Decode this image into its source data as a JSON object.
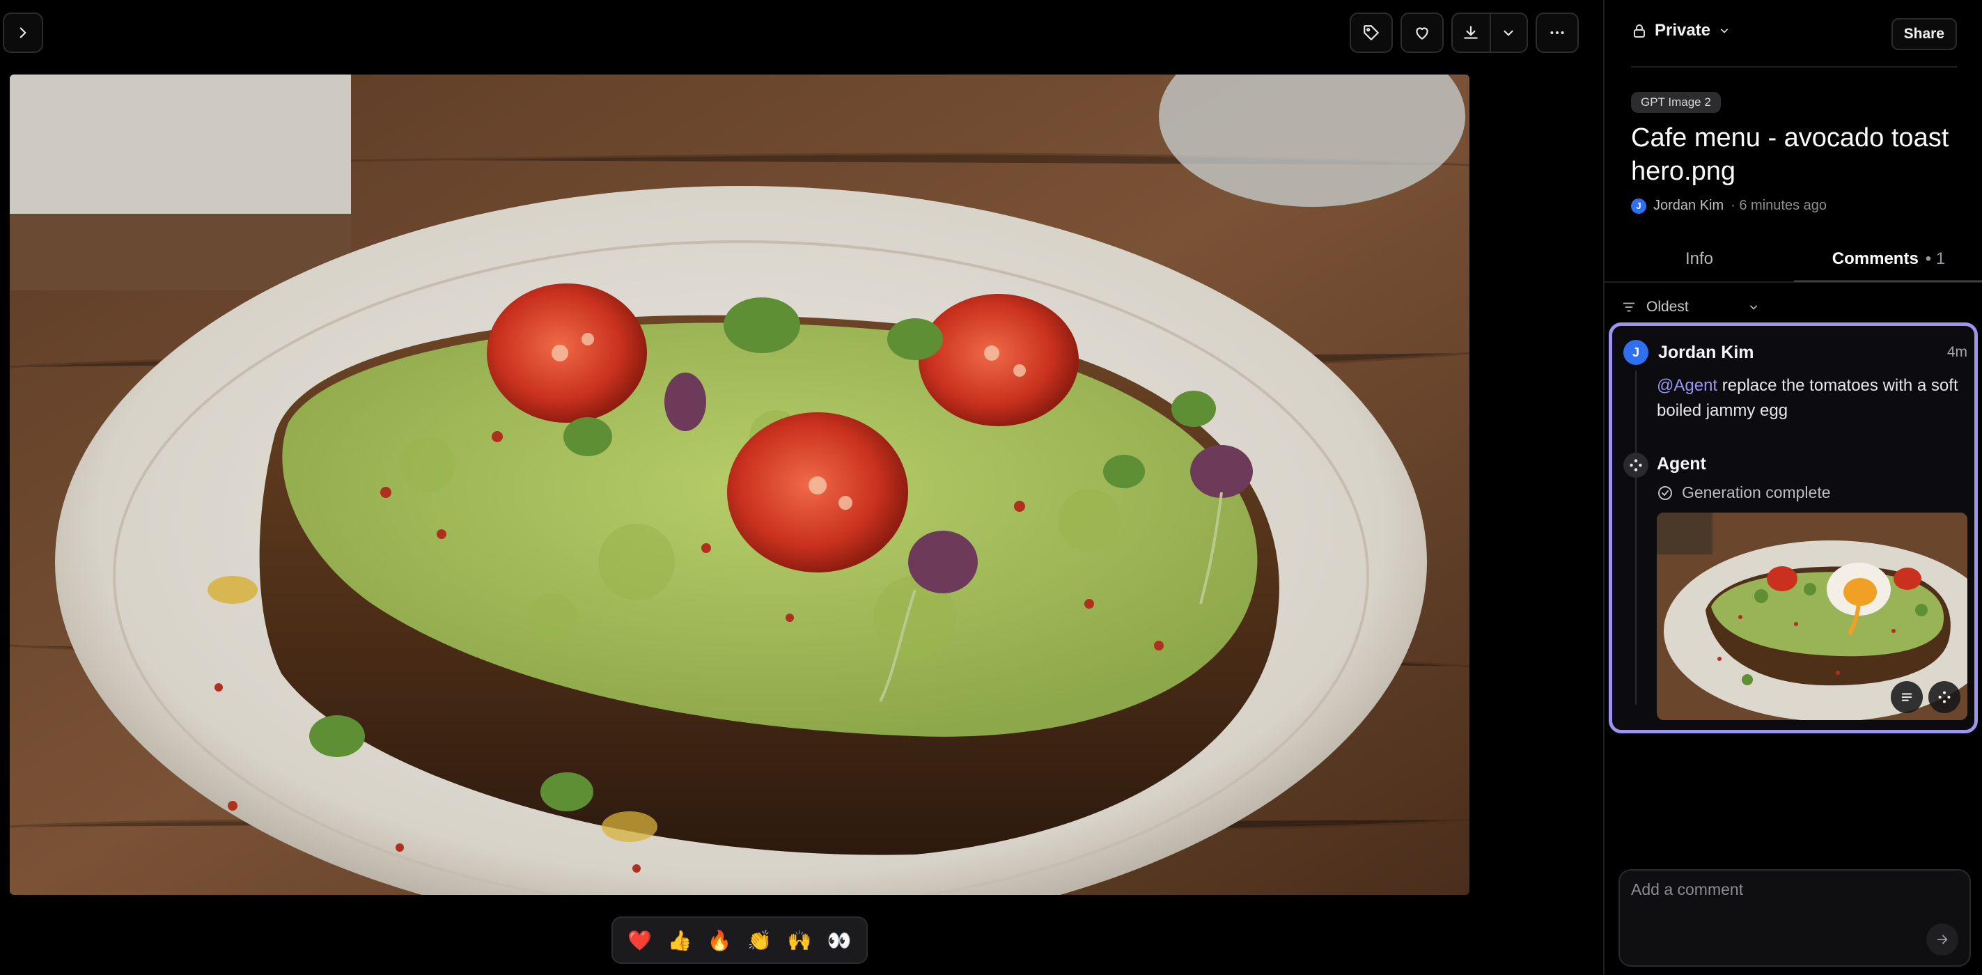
{
  "toolbar": {
    "icons": [
      "chevron-right-icon",
      "tag-icon",
      "heart-icon",
      "download-icon",
      "chevron-down-icon",
      "more-horizontal-icon"
    ]
  },
  "image": {
    "subject": "avocado toast with cherry tomatoes, microgreens and chili flakes on a ceramic plate"
  },
  "reactions": [
    "❤️",
    "👍",
    "🔥",
    "👏",
    "🙌",
    "👀"
  ],
  "panel": {
    "visibility": "Private",
    "share_label": "Share",
    "model_badge": "GPT Image 2",
    "title": "Cafe menu - avocado toast hero.png",
    "author_initial": "J",
    "author": "Jordan Kim",
    "meta": "· 6 minutes ago",
    "tabs": [
      {
        "label": "Info",
        "active": false
      },
      {
        "label": "Comments",
        "active": true,
        "count": "• 1"
      }
    ],
    "sort_label": "Oldest"
  },
  "comment": {
    "avatar_initial": "J",
    "author": "Jordan Kim",
    "time": "4m",
    "mention": "@Agent",
    "text": " replace the tomatoes with a soft boiled jammy egg"
  },
  "agent": {
    "name": "Agent",
    "status": "Generation complete"
  },
  "composer": {
    "placeholder": "Add a comment"
  },
  "colors": {
    "accent": "#9b95ef",
    "avatar": "#2f6ff2",
    "background": "#000000"
  }
}
